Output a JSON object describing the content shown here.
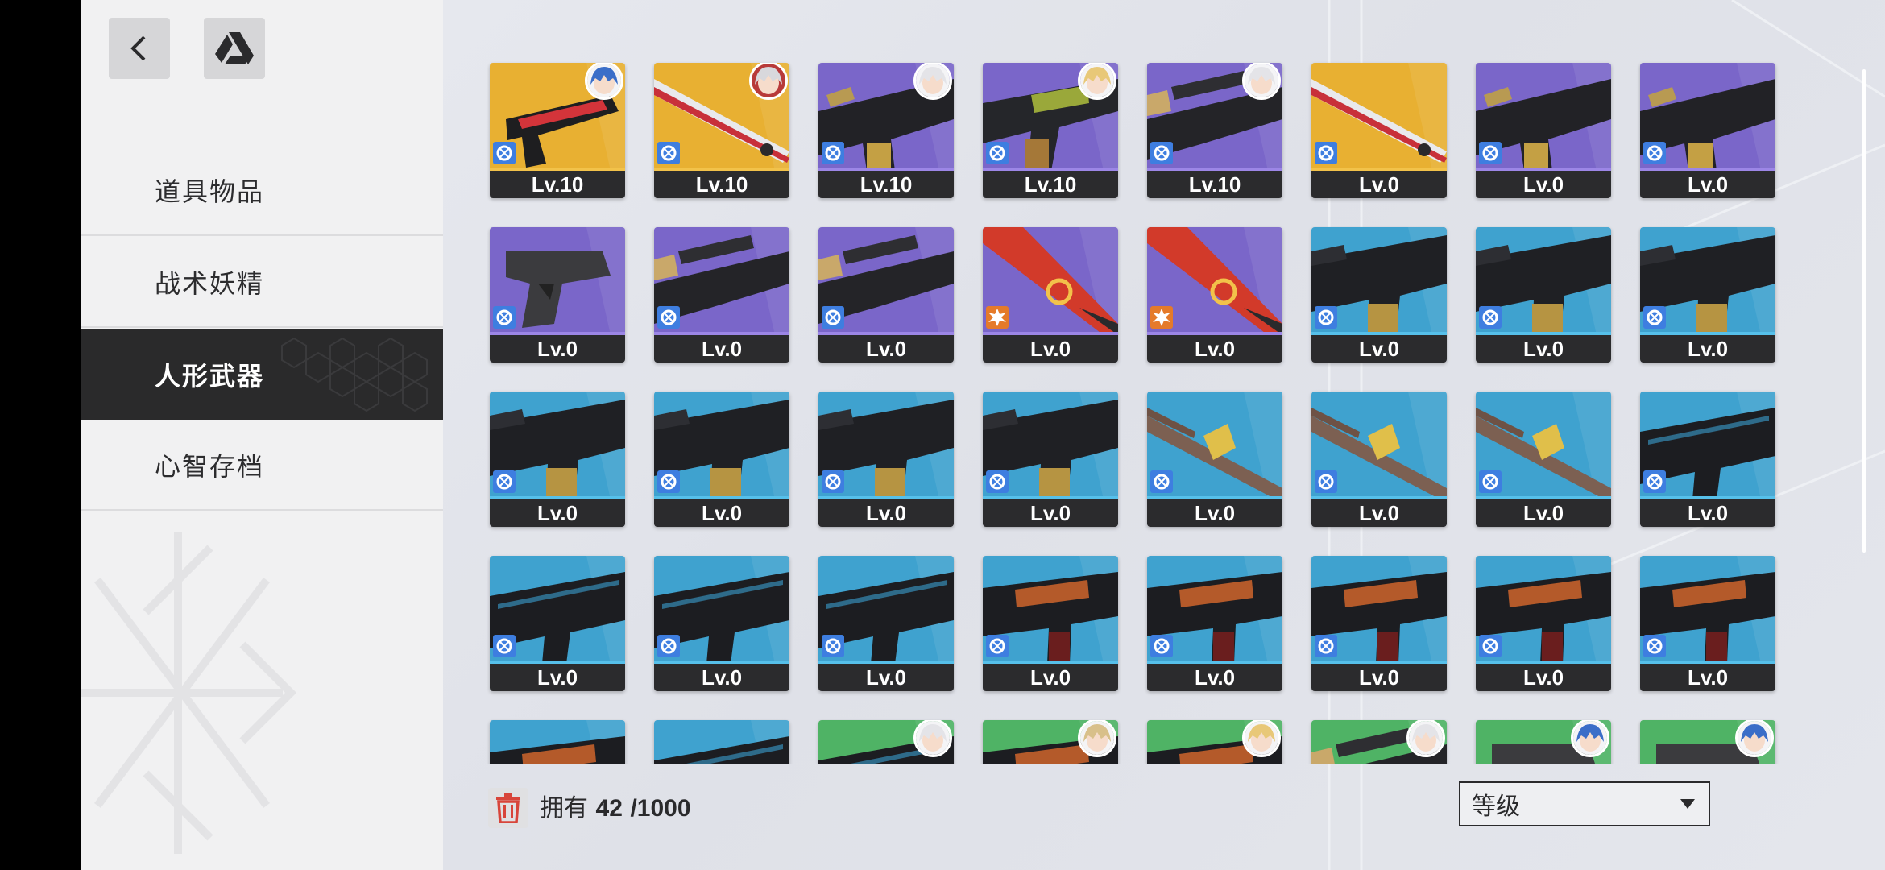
{
  "sidebar": {
    "icons": {
      "back": "chevron-left-icon",
      "drive": "drive-triangle-icon"
    },
    "items": [
      {
        "label": "道具物品",
        "active": false
      },
      {
        "label": "战术妖精",
        "active": false
      },
      {
        "label": "人形武器",
        "active": true
      },
      {
        "label": "心智存档",
        "active": false
      }
    ]
  },
  "inventory": {
    "owned_label": "拥有",
    "owned_count": "42",
    "owned_max": "/1000",
    "sort_selected": "等级"
  },
  "colors": {
    "purple": "#7a66c9",
    "gold": "#e8b032",
    "blue": "#3fa2cf",
    "green": "#4fb365",
    "red": "#d23a2a",
    "dark": "#2b2b2d"
  },
  "weapons": [
    {
      "bg": "gold",
      "art": "smg-red",
      "elem": "hydro",
      "lv": "Lv.10",
      "avatar": "blue"
    },
    {
      "bg": "gold",
      "art": "rifle-white",
      "elem": "hydro",
      "lv": "Lv.10",
      "avatar": "white-red"
    },
    {
      "bg": "purple",
      "art": "smg-tan",
      "elem": "hydro",
      "lv": "Lv.10",
      "avatar": "white"
    },
    {
      "bg": "purple",
      "art": "rifle-green",
      "elem": "hydro",
      "lv": "Lv.10",
      "avatar": "blonde"
    },
    {
      "bg": "purple",
      "art": "sniper-tan",
      "elem": "hydro",
      "lv": "Lv.10",
      "avatar": "white"
    },
    {
      "bg": "gold",
      "art": "rifle-white",
      "elem": "hydro",
      "lv": "Lv.0",
      "avatar": null
    },
    {
      "bg": "purple",
      "art": "smg-tan",
      "elem": "hydro",
      "lv": "Lv.0",
      "avatar": null
    },
    {
      "bg": "purple",
      "art": "smg-tan",
      "elem": "hydro",
      "lv": "Lv.0",
      "avatar": null
    },
    {
      "bg": "purple",
      "art": "pistol",
      "elem": "hydro",
      "lv": "Lv.0",
      "avatar": null
    },
    {
      "bg": "purple",
      "art": "sniper-tan",
      "elem": "hydro",
      "lv": "Lv.0",
      "avatar": null
    },
    {
      "bg": "purple",
      "art": "sniper-tan",
      "elem": "hydro",
      "lv": "Lv.0",
      "avatar": null
    },
    {
      "bg": "purple",
      "art": "red-blade",
      "elem": "burn",
      "lv": "Lv.0",
      "avatar": null
    },
    {
      "bg": "purple",
      "art": "red-blade",
      "elem": "burn",
      "lv": "Lv.0",
      "avatar": null
    },
    {
      "bg": "blue",
      "art": "ar-gold",
      "elem": "hydro",
      "lv": "Lv.0",
      "avatar": null
    },
    {
      "bg": "blue",
      "art": "ar-gold",
      "elem": "hydro",
      "lv": "Lv.0",
      "avatar": null
    },
    {
      "bg": "blue",
      "art": "ar-gold",
      "elem": "hydro",
      "lv": "Lv.0",
      "avatar": null
    },
    {
      "bg": "blue",
      "art": "ar-gold",
      "elem": "hydro",
      "lv": "Lv.0",
      "avatar": null
    },
    {
      "bg": "blue",
      "art": "ar-gold",
      "elem": "hydro",
      "lv": "Lv.0",
      "avatar": null
    },
    {
      "bg": "blue",
      "art": "ar-gold",
      "elem": "hydro",
      "lv": "Lv.0",
      "avatar": null
    },
    {
      "bg": "blue",
      "art": "ar-gold",
      "elem": "hydro",
      "lv": "Lv.0",
      "avatar": null
    },
    {
      "bg": "blue",
      "art": "spear",
      "elem": "hydro",
      "lv": "Lv.0",
      "avatar": null
    },
    {
      "bg": "blue",
      "art": "spear",
      "elem": "hydro",
      "lv": "Lv.0",
      "avatar": null
    },
    {
      "bg": "blue",
      "art": "spear",
      "elem": "hydro",
      "lv": "Lv.0",
      "avatar": null
    },
    {
      "bg": "blue",
      "art": "smg-black",
      "elem": "hydro",
      "lv": "Lv.0",
      "avatar": null
    },
    {
      "bg": "blue",
      "art": "smg-black",
      "elem": "hydro",
      "lv": "Lv.0",
      "avatar": null
    },
    {
      "bg": "blue",
      "art": "smg-black",
      "elem": "hydro",
      "lv": "Lv.0",
      "avatar": null
    },
    {
      "bg": "blue",
      "art": "smg-black",
      "elem": "hydro",
      "lv": "Lv.0",
      "avatar": null
    },
    {
      "bg": "blue",
      "art": "ak-wood",
      "elem": "hydro",
      "lv": "Lv.0",
      "avatar": null
    },
    {
      "bg": "blue",
      "art": "ak-wood",
      "elem": "hydro",
      "lv": "Lv.0",
      "avatar": null
    },
    {
      "bg": "blue",
      "art": "ak-wood",
      "elem": "hydro",
      "lv": "Lv.0",
      "avatar": null
    },
    {
      "bg": "blue",
      "art": "ak-wood",
      "elem": "hydro",
      "lv": "Lv.0",
      "avatar": null
    },
    {
      "bg": "blue",
      "art": "ak-wood",
      "elem": "hydro",
      "lv": "Lv.0",
      "avatar": null
    },
    {
      "bg": "blue",
      "art": "ak-wood",
      "elem": "hydro",
      "lv": "",
      "avatar": null
    },
    {
      "bg": "blue",
      "art": "smg-black",
      "elem": "hydro",
      "lv": "",
      "avatar": null
    },
    {
      "bg": "green",
      "art": "smg-black",
      "elem": "hydro",
      "lv": "",
      "avatar": "white"
    },
    {
      "bg": "green",
      "art": "ak-wood",
      "elem": "hydro",
      "lv": "",
      "avatar": "blonde-dark"
    },
    {
      "bg": "green",
      "art": "ak-wood",
      "elem": "hydro",
      "lv": "",
      "avatar": "blonde"
    },
    {
      "bg": "green",
      "art": "sniper-tan",
      "elem": "hydro",
      "lv": "",
      "avatar": "white"
    },
    {
      "bg": "green",
      "art": "pistol",
      "elem": "hydro",
      "lv": "",
      "avatar": "blue"
    },
    {
      "bg": "green",
      "art": "pistol",
      "elem": "hydro",
      "lv": "",
      "avatar": "blue"
    }
  ]
}
